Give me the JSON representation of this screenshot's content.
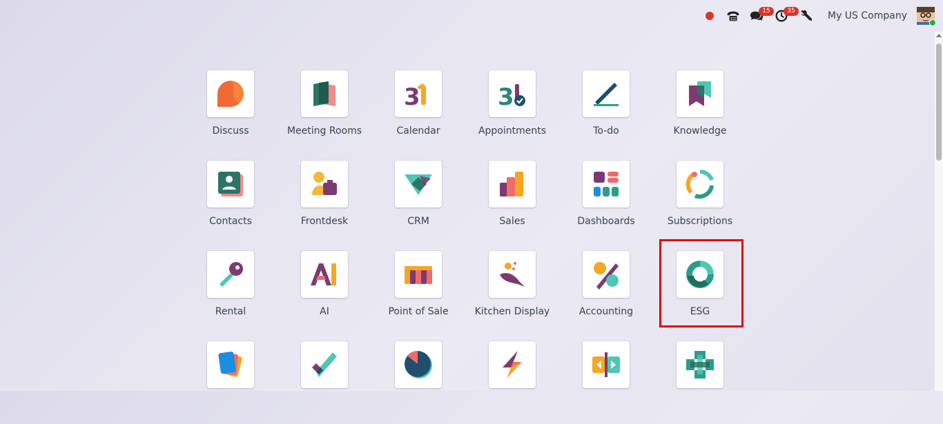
{
  "topbar": {
    "company": "My US Company",
    "messages_count": "15",
    "activities_count": "35"
  },
  "colors": {
    "badge": "#d9342b",
    "highlight": "#e00000"
  },
  "apps": [
    {
      "label": "Discuss",
      "icon": "discuss-icon"
    },
    {
      "label": "Meeting Rooms",
      "icon": "meeting-rooms-icon"
    },
    {
      "label": "Calendar",
      "icon": "calendar-icon"
    },
    {
      "label": "Appointments",
      "icon": "appointments-icon"
    },
    {
      "label": "To-do",
      "icon": "todo-icon"
    },
    {
      "label": "Knowledge",
      "icon": "knowledge-icon"
    },
    {
      "label": "Contacts",
      "icon": "contacts-icon"
    },
    {
      "label": "Frontdesk",
      "icon": "frontdesk-icon"
    },
    {
      "label": "CRM",
      "icon": "crm-icon"
    },
    {
      "label": "Sales",
      "icon": "sales-icon"
    },
    {
      "label": "Dashboards",
      "icon": "dashboards-icon"
    },
    {
      "label": "Subscriptions",
      "icon": "subscriptions-icon"
    },
    {
      "label": "Rental",
      "icon": "rental-icon"
    },
    {
      "label": "AI",
      "icon": "ai-icon"
    },
    {
      "label": "Point of Sale",
      "icon": "point-of-sale-icon"
    },
    {
      "label": "Kitchen Display",
      "icon": "kitchen-display-icon"
    },
    {
      "label": "Accounting",
      "icon": "accounting-icon"
    },
    {
      "label": "ESG",
      "icon": "esg-icon"
    },
    {
      "label": "",
      "icon": "documents-icon"
    },
    {
      "label": "",
      "icon": "project-icon"
    },
    {
      "label": "",
      "icon": "timesheets-icon"
    },
    {
      "label": "",
      "icon": "planning-icon"
    },
    {
      "label": "",
      "icon": "field-service-icon"
    },
    {
      "label": "",
      "icon": "helpdesk-icon"
    }
  ]
}
